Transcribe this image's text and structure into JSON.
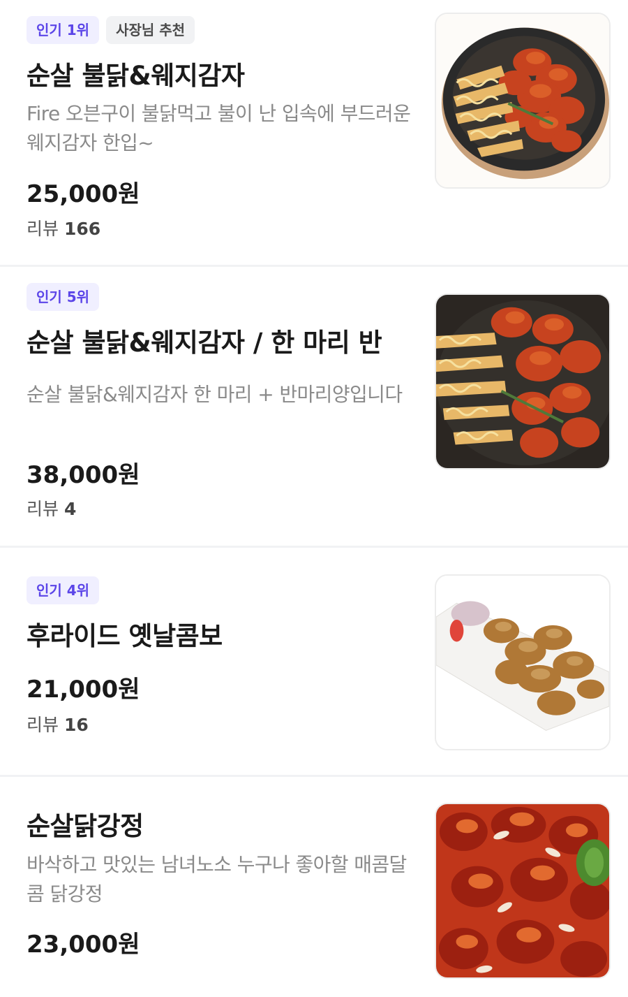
{
  "menu": {
    "items": [
      {
        "badges": [
          "인기 1위",
          "사장님 추천"
        ],
        "title": "순살 불닭&웨지감자",
        "desc": "Fire 오븐구이 불닭먹고 불이 난 입속에 부드러운 웨지감자 한입~",
        "price": "25,000원",
        "review_label": "리뷰",
        "review_count": "166",
        "image_icon": "spicy-chicken-with-wedges-photo"
      },
      {
        "badges": [
          "인기 5위"
        ],
        "title": "순살 불닭&웨지감자 / 한 마리 반",
        "desc": "순살 불닭&웨지감자 한 마리 + 반마리양입니다",
        "price": "38,000원",
        "review_label": "리뷰",
        "review_count": "4",
        "image_icon": "spicy-chicken-with-wedges-photo"
      },
      {
        "badges": [
          "인기 4위"
        ],
        "title": "후라이드 옛날콤보",
        "desc": "",
        "price": "21,000원",
        "review_label": "리뷰",
        "review_count": "16",
        "image_icon": "fried-chicken-platter-photo"
      },
      {
        "badges": [],
        "title": "순살닭강정",
        "desc": "바삭하고 맛있는 남녀노소 누구나 좋아할 매콤달콤 닭강정",
        "price": "23,000원",
        "review_label": "",
        "review_count": "",
        "image_icon": "sweet-spicy-chicken-bites-photo"
      }
    ]
  }
}
